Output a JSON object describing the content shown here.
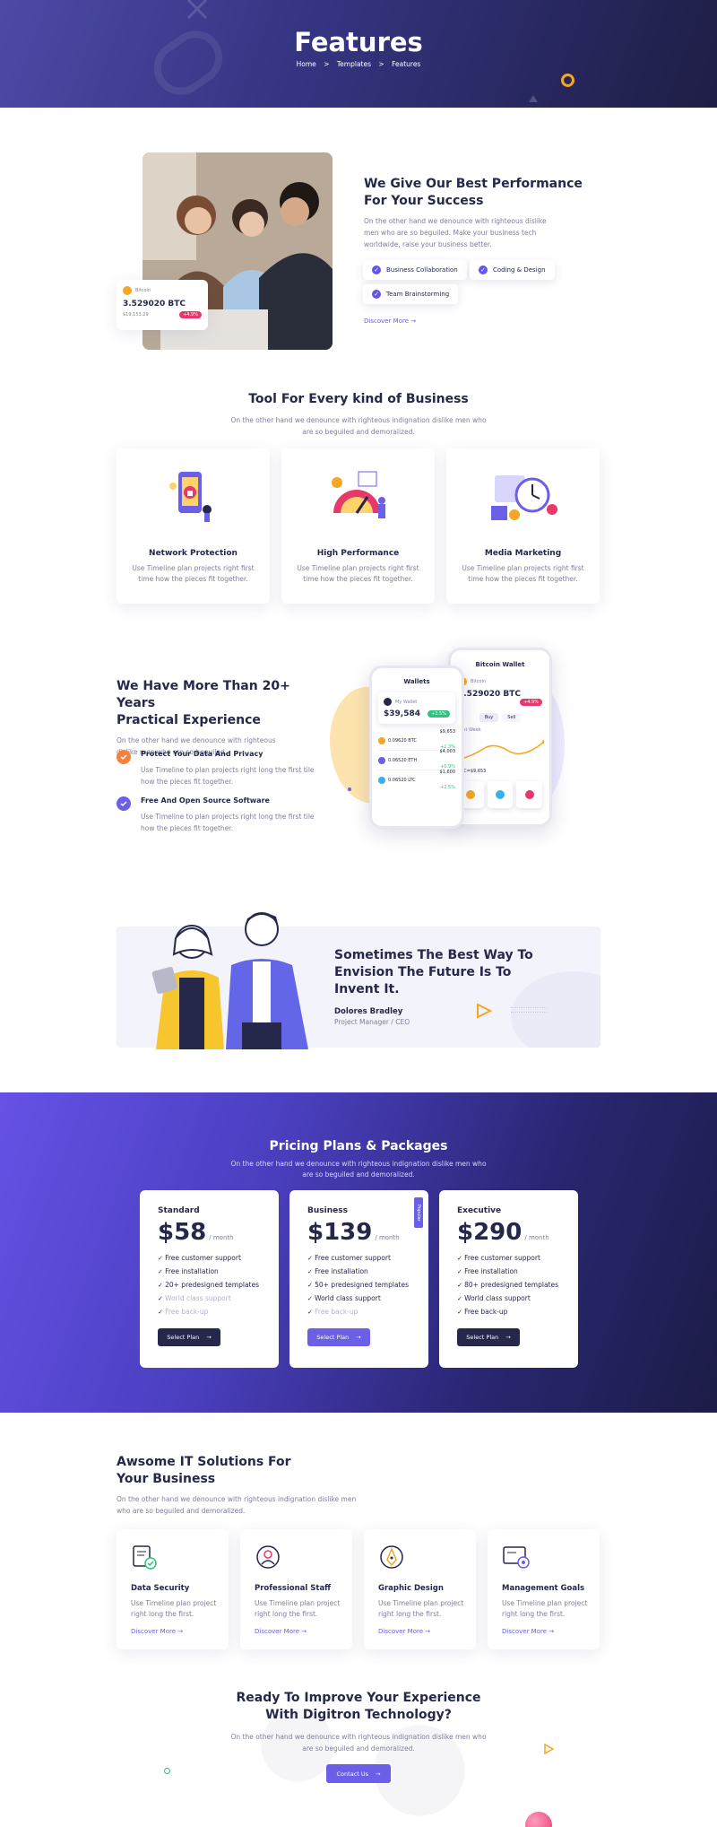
{
  "hero": {
    "title": "Features",
    "breadcrumb": [
      "Home",
      "Templates",
      "Features"
    ],
    "separator": ">"
  },
  "performance": {
    "title_line1": "We Give Our Best Performance",
    "title_line2": "For Your Success",
    "desc_line1": "On the other hand we denounce with righteous dislike",
    "desc_line2": "men who are so beguiled. Make your business tech",
    "desc_line3": "worldwide, raise your business better.",
    "chips": [
      "Business Collaboration",
      "Coding & Design",
      "Team Brainstorming"
    ],
    "link": "Discover More",
    "btc_card": {
      "label": "Bitcoin",
      "value": "3.529020 BTC",
      "sub": "$19,153.29",
      "badge": "+4.9%"
    }
  },
  "tools": {
    "title": "Tool For Every kind of Business",
    "desc_line1": "On the other hand we denounce with righteous indignation dislike men who",
    "desc_line2": "are so beguiled and demoralized.",
    "items": [
      {
        "title": "Network Protection",
        "desc_line1": "Use Timeline plan projects right first",
        "desc_line2": "time how the pieces fit together."
      },
      {
        "title": "High Performance",
        "desc_line1": "Use Timeline plan projects right first",
        "desc_line2": "time how the pieces fit together."
      },
      {
        "title": "Media Marketing",
        "desc_line1": "Use Timeline plan projects right first",
        "desc_line2": "time how the pieces fit together."
      }
    ]
  },
  "experience": {
    "title_line1": "We Have More Than 20+ Years",
    "title_line2": "Practical Experience",
    "desc_line1": "On the other hand we denounce with righteous",
    "desc_line2": "dislike men who are so beguiled.",
    "items": [
      {
        "title": "Protect Your Data And Privacy",
        "desc_line1": "Use Timeline to plan projects right long the first tile",
        "desc_line2": "how the pieces fit together."
      },
      {
        "title": "Free And Open Source Software",
        "desc_line1": "Use Timeline to plan projects right long the first tile",
        "desc_line2": "how the pieces fit together."
      }
    ],
    "wallet_phone": {
      "title": "Wallets",
      "card_label": "My Wallet",
      "balance": "$39,584",
      "badge": "+3.5%",
      "rows": [
        {
          "name": "0.09620 BTC",
          "val": "$9,653",
          "change": "+1.3%"
        },
        {
          "name": "0.06520 ETH",
          "val": "$4,003",
          "change": "+0.9%"
        },
        {
          "name": "0.06520 LTC",
          "val": "$1,600",
          "change": "+2.5%"
        }
      ]
    },
    "bitcoin_phone": {
      "title": "Bitcoin Wallet",
      "label": "Bitcoin",
      "value": "3.529020 BTC",
      "badge": "+4.9%",
      "tabs": [
        "Buy",
        "Sell"
      ],
      "chart_label": "Last Week",
      "price_label": "BTC=$9,653"
    }
  },
  "quote": {
    "line1": "Sometimes The Best Way To",
    "line2": "Envision The Future Is To",
    "line3": "Invent It.",
    "author": "Dolores Bradley",
    "role": "Project Manager / CEO"
  },
  "pricing": {
    "title": "Pricing Plans & Packages",
    "desc_line1": "On the other hand we denounce with righteous indignation dislike men who",
    "desc_line2": "are so beguiled and demoralized.",
    "badge": "Popular",
    "plans": [
      {
        "name": "Standard",
        "price": "$58",
        "per": "/ month",
        "features": [
          "Free customer support",
          "Free installation",
          "20+ predesigned templates",
          "World class support",
          "Free back-up"
        ],
        "button": "Select Plan"
      },
      {
        "name": "Business",
        "price": "$139",
        "per": "/ month",
        "features": [
          "Free customer support",
          "Free installation",
          "50+ predesigned templates",
          "World class support",
          "Free back-up"
        ],
        "button": "Select Plan"
      },
      {
        "name": "Executive",
        "price": "$290",
        "per": "/ month",
        "features": [
          "Free customer support",
          "Free installation",
          "80+ predesigned templates",
          "World class support",
          "Free back-up"
        ],
        "button": "Select Plan"
      }
    ]
  },
  "solutions": {
    "title_line1": "Awsome IT Solutions For",
    "title_line2": "Your Business",
    "desc_line1": "On the other hand we denounce with righteous indignation dislike men",
    "desc_line2": "who are so beguiled and demoralized.",
    "link": "Discover More",
    "items": [
      {
        "title": "Data Security",
        "desc_line1": "Use Timeline plan project",
        "desc_line2": "right long the first."
      },
      {
        "title": "Professional Staff",
        "desc_line1": "Use Timeline plan project",
        "desc_line2": "right long the first."
      },
      {
        "title": "Graphic Design",
        "desc_line1": "Use Timeline plan project",
        "desc_line2": "right long the first."
      },
      {
        "title": "Management Goals",
        "desc_line1": "Use Timeline plan project",
        "desc_line2": "right long the first."
      }
    ]
  },
  "cta": {
    "title_line1": "Ready To Improve Your Experience",
    "title_line2": "With Digitron Technology?",
    "desc_line1": "On the other hand we denounce with righteous indignation dislike men who",
    "desc_line2": "are so beguiled and demoralized.",
    "button": "Contact Us"
  },
  "colors": {
    "accent": "#6a5fe6",
    "dark": "#25284a",
    "orange": "#f5a623",
    "pink": "#e8386b"
  }
}
